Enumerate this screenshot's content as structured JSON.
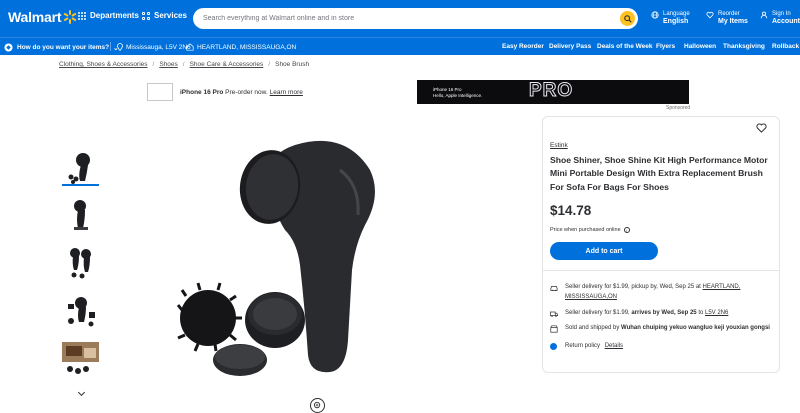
{
  "header": {
    "logo": "Walmart",
    "departments": "Departments",
    "services": "Services",
    "search_placeholder": "Search everything at Walmart online and in store",
    "language_label": "Language",
    "language_value": "English",
    "reorder_label": "Reorder",
    "reorder_value": "My Items",
    "signin_label": "Sign In",
    "signin_value": "Account"
  },
  "subnav": {
    "delivery_prompt": "How do you want your items?",
    "postal": "Mississauga, L5V 2N6",
    "store": "HEARTLAND, MISSISSAUGA,ON",
    "links": [
      "Easy Reorder",
      "Delivery Pass",
      "Deals of the Week",
      "Flyers",
      "Halloween",
      "Thanksgiving",
      "Rollback"
    ]
  },
  "breadcrumb": [
    "Clothing, Shoes & Accessories",
    "Shoes",
    "Shoe Care & Accessories",
    "Shoe Brush"
  ],
  "ad": {
    "product": "iPhone 16 Pro",
    "text": "Pre-order now.",
    "link": "Learn more",
    "banner_line1": "iPhone 16 Pro",
    "banner_line2": "Hello, Apple Intelligence.",
    "banner_big": "PRO",
    "sponsored": "Sponsored"
  },
  "product": {
    "brand": "Estink",
    "title": "Shoe Shiner, Shoe Shine Kit High Performance Motor Mini Portable Design With Extra Replacement Brush For Sofa For Bags For Shoes",
    "price": "$14.78",
    "price_note": "Price when purchased online",
    "add_to_cart": "Add to cart"
  },
  "fulfillment": {
    "pickup_pre": "Seller delivery for $1.99, pickup by, Wed, Sep 25 at",
    "pickup_store": "HEARTLAND, MISSISSAUGA,ON",
    "delivery_pre": "Seller delivery for $1.99,",
    "delivery_bold": "arrives by Wed, Sep 25",
    "delivery_to": "to",
    "delivery_postal": "L5V 2N6",
    "seller_pre": "Sold and shipped by",
    "seller_name": "Wuhan chuiping yekuo wangluo keji youxian gongsi",
    "return_label": "Return policy",
    "return_link": "Details"
  },
  "colors": {
    "brand_blue": "#0071dc",
    "spark_yellow": "#ffc220"
  }
}
